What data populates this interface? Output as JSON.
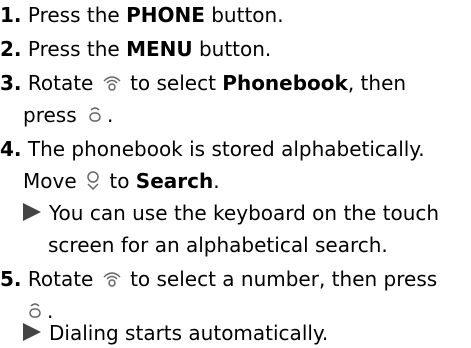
{
  "steps": [
    {
      "num": "1.",
      "pre": "Press the ",
      "bold": "PHONE",
      "post": " button."
    },
    {
      "num": "2.",
      "pre": "Press the ",
      "bold": "MENU",
      "post": " button."
    },
    {
      "num": "3.",
      "pre": "Rotate ",
      "mid": " to select ",
      "bold": "Phonebook",
      "post": ", then",
      "cont": "press",
      "end": "."
    },
    {
      "num": "4.",
      "line1": "The phonebook is stored alphabetically.",
      "pre": "Move ",
      "mid": " to ",
      "bold": "Search",
      "post": ".",
      "sub1": "You can use the keyboard on the touch",
      "sub2": "screen for an alphabetical search."
    },
    {
      "num": "5.",
      "pre": "Rotate ",
      "mid": " to select a number, then press",
      "end": ".",
      "sub1": "Dialing starts automatically."
    }
  ],
  "icons": [
    "rotate-icon",
    "press-icon",
    "move-down-icon"
  ]
}
